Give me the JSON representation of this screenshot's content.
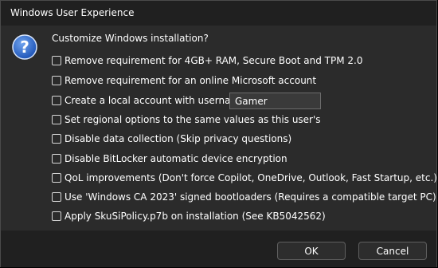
{
  "window": {
    "title": "Windows User Experience"
  },
  "dialog": {
    "icon": "question-icon",
    "prompt": "Customize Windows installation?",
    "options": [
      {
        "label": "Remove requirement for 4GB+ RAM, Secure Boot and TPM 2.0",
        "checked": false
      },
      {
        "label": "Remove requirement for an online Microsoft account",
        "checked": false
      },
      {
        "label": "Create a local account with username:",
        "checked": false
      },
      {
        "label": "Set regional options to the same values as this user's",
        "checked": false
      },
      {
        "label": "Disable data collection (Skip privacy questions)",
        "checked": false
      },
      {
        "label": "Disable BitLocker automatic device encryption",
        "checked": false
      },
      {
        "label": "QoL improvements (Don't force Copilot, OneDrive, Outlook, Fast Startup, etc.)",
        "checked": false
      },
      {
        "label": "Use 'Windows CA 2023' signed bootloaders (Requires a compatible target PC)",
        "checked": false
      },
      {
        "label": "Apply SkuSiPolicy.p7b on installation (See KB5042562)",
        "checked": false
      }
    ],
    "username_value": "Gamer"
  },
  "buttons": {
    "ok": "OK",
    "cancel": "Cancel"
  },
  "colors": {
    "dialog_background": "#2b2b2b",
    "titlebar_background": "#202020",
    "icon_accent": "#2b6fd6",
    "text": "#ffffff"
  }
}
